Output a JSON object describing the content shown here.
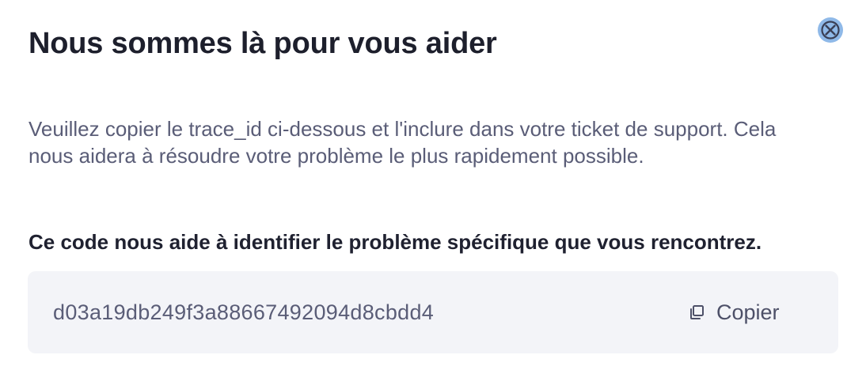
{
  "dialog": {
    "title": "Nous sommes là pour vous aider",
    "close_icon": "close-circle-icon",
    "description": "Veuillez copier le trace_id ci-dessous et l'inclure dans votre ticket de support. Cela nous aidera à résoudre votre problème le plus rapidement possible.",
    "subtitle": "Ce code nous aide à identifier le problème spécifique que vous rencontrez.",
    "trace_id": "d03a19db249f3a88667492094d8cbdd4",
    "copy_label": "Copier",
    "copy_icon": "copy-icon"
  },
  "colors": {
    "close_bg": "#8fb9e8",
    "code_bg": "#f3f4f8",
    "title_text": "#1d1f2c",
    "body_text": "#5a5d77"
  }
}
